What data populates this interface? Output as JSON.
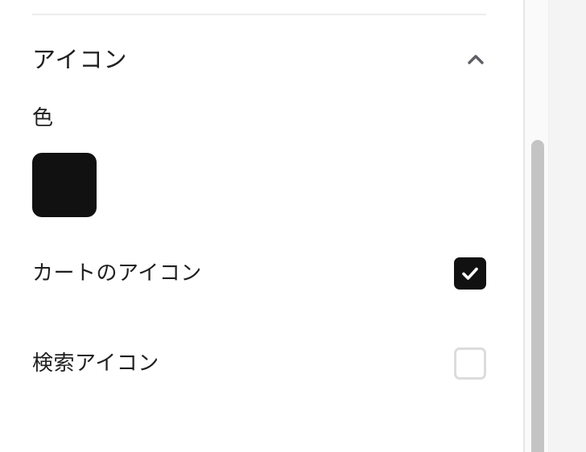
{
  "icon_section": {
    "title": "アイコン",
    "expanded": true,
    "color_label": "色",
    "color_value": "#111111",
    "options": [
      {
        "label": "カートのアイコン",
        "checked": true
      },
      {
        "label": "検索アイコン",
        "checked": false
      }
    ]
  },
  "icons": {
    "collapse": "chevron-up-icon",
    "check": "checkmark-icon"
  },
  "colors": {
    "accent": "#111111",
    "checkbox_border": "#dcdcdc",
    "divider": "#ececec",
    "scrollbar": "#c4c4c4"
  }
}
